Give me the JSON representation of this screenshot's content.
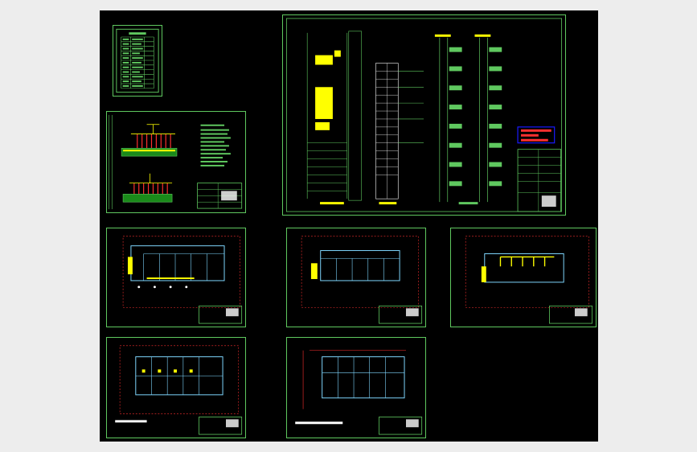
{
  "window": {
    "background_color": "#ededed",
    "canvas_color": "#000000"
  },
  "drawing": {
    "description_colors": {
      "frame": "#5fc85f",
      "walls": "#7fd7ff",
      "annotation": "#ffff00",
      "equipment": "#ff3030",
      "title_block_highlight": "#1a1aff"
    },
    "sheets": [
      {
        "id": "legend-table",
        "type": "table"
      },
      {
        "id": "fire-alarm-system",
        "type": "system-diagram"
      },
      {
        "id": "power-distribution-system",
        "type": "system-diagram"
      },
      {
        "id": "floor-plan-1",
        "type": "floor-plan"
      },
      {
        "id": "floor-plan-2",
        "type": "floor-plan"
      },
      {
        "id": "floor-plan-3",
        "type": "floor-plan"
      },
      {
        "id": "floor-plan-4",
        "type": "floor-plan"
      },
      {
        "id": "roof-plan",
        "type": "floor-plan"
      }
    ]
  }
}
